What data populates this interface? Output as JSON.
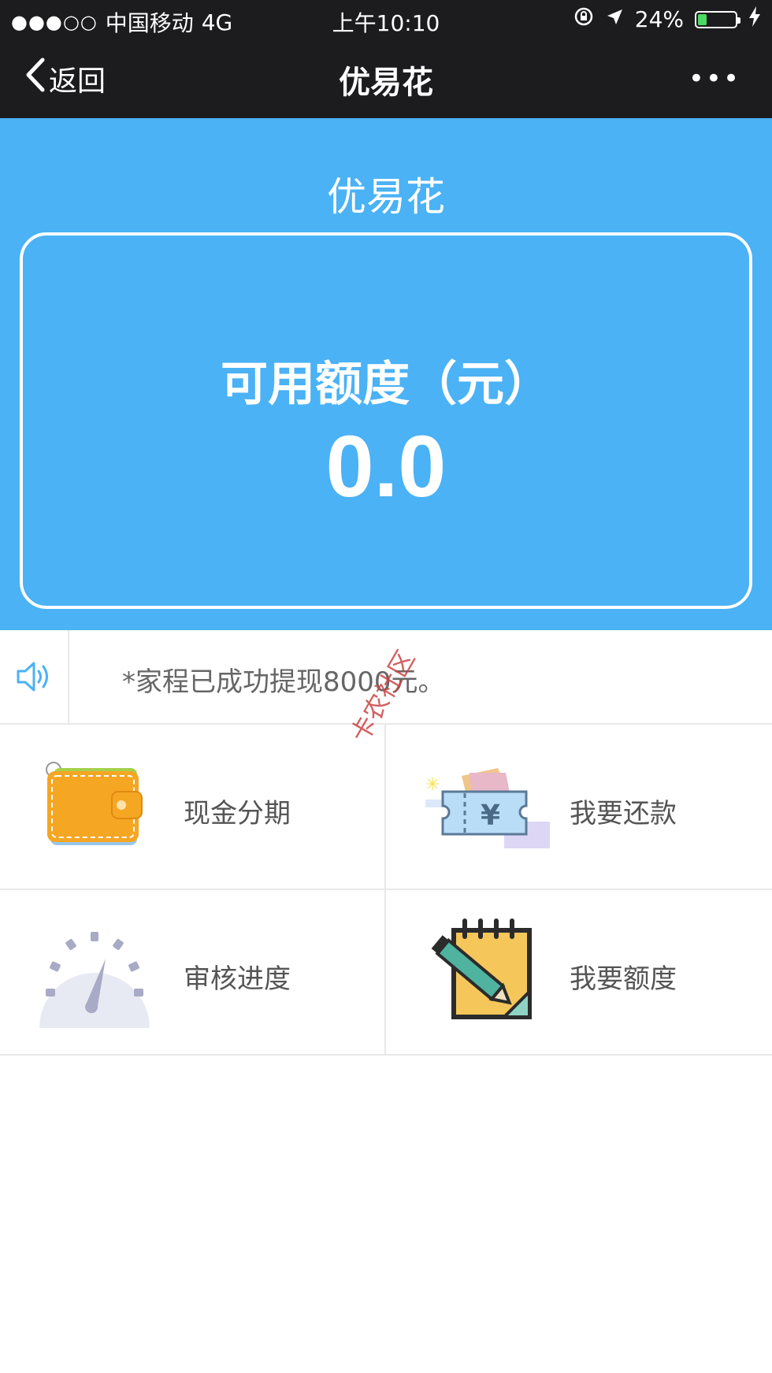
{
  "status_bar": {
    "signal": "●●●○○",
    "carrier": "中国移动",
    "network": "4G",
    "time": "上午10:10",
    "battery": "24%",
    "battery_level": 0.24
  },
  "nav": {
    "back_label": "返回",
    "title": "优易花",
    "more_label": "•••"
  },
  "hero": {
    "brand": "优易花",
    "credit_label": "可用额度（元）",
    "credit_amount": "0.0"
  },
  "notice": {
    "text": "*家程已成功提现8000元。"
  },
  "menu": [
    {
      "label": "现金分期",
      "icon": "wallet-icon"
    },
    {
      "label": "我要还款",
      "icon": "ticket-yen-icon"
    },
    {
      "label": "审核进度",
      "icon": "gauge-icon"
    },
    {
      "label": "我要额度",
      "icon": "notepad-pencil-icon"
    }
  ],
  "watermark": "卡农社区",
  "colors": {
    "accent": "#4ab2f5",
    "bar": "#1c1c1e"
  }
}
